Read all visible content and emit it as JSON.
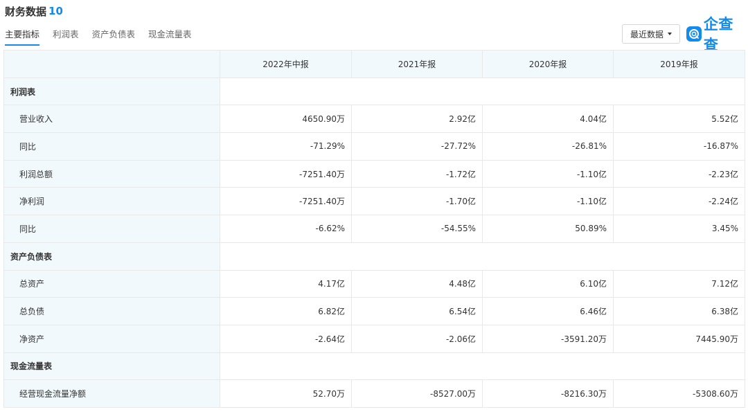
{
  "header": {
    "title": "财务数据",
    "count": "10"
  },
  "tabs": [
    {
      "label": "主要指标",
      "active": true
    },
    {
      "label": "利润表",
      "active": false
    },
    {
      "label": "资产负债表",
      "active": false
    },
    {
      "label": "现金流量表",
      "active": false
    }
  ],
  "dropdown": {
    "label": "最近数据"
  },
  "logo": {
    "text": "企查查"
  },
  "table": {
    "columns": [
      "2022年中报",
      "2021年报",
      "2020年报",
      "2019年报"
    ],
    "sections": [
      {
        "title": "利润表",
        "rows": [
          {
            "label": "营业收入",
            "values": [
              "4650.90万",
              "2.92亿",
              "4.04亿",
              "5.52亿"
            ]
          },
          {
            "label": "同比",
            "values": [
              "-71.29%",
              "-27.72%",
              "-26.81%",
              "-16.87%"
            ]
          },
          {
            "label": "利润总额",
            "values": [
              "-7251.40万",
              "-1.72亿",
              "-1.10亿",
              "-2.23亿"
            ]
          },
          {
            "label": "净利润",
            "values": [
              "-7251.40万",
              "-1.70亿",
              "-1.10亿",
              "-2.24亿"
            ]
          },
          {
            "label": "同比",
            "values": [
              "-6.62%",
              "-54.55%",
              "50.89%",
              "3.45%"
            ]
          }
        ]
      },
      {
        "title": "资产负债表",
        "rows": [
          {
            "label": "总资产",
            "values": [
              "4.17亿",
              "4.48亿",
              "6.10亿",
              "7.12亿"
            ]
          },
          {
            "label": "总负债",
            "values": [
              "6.82亿",
              "6.54亿",
              "6.46亿",
              "6.38亿"
            ]
          },
          {
            "label": "净资产",
            "values": [
              "-2.64亿",
              "-2.06亿",
              "-3591.20万",
              "7445.90万"
            ]
          }
        ]
      },
      {
        "title": "现金流量表",
        "rows": [
          {
            "label": "经营现金流量净额",
            "values": [
              "52.70万",
              "-8527.00万",
              "-8216.30万",
              "-5308.60万"
            ]
          }
        ]
      }
    ]
  },
  "colors": {
    "accent": "#128bed",
    "header_bg": "#f2f9fc",
    "border": "#e8e8e8"
  }
}
